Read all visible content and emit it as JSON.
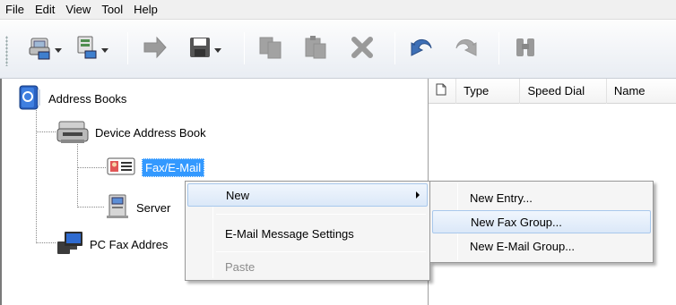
{
  "menubar": {
    "items": [
      {
        "label": "File"
      },
      {
        "label": "Edit"
      },
      {
        "label": "View"
      },
      {
        "label": "Tool"
      },
      {
        "label": "Help"
      }
    ]
  },
  "toolbar": {
    "buttons": [
      {
        "icon": "address-book-dropdown-icon",
        "has_dropdown": true
      },
      {
        "icon": "network-dropdown-icon",
        "has_dropdown": true
      },
      {
        "icon": "import-arrow-icon",
        "has_dropdown": false
      },
      {
        "icon": "save-disk-icon",
        "has_dropdown": true
      },
      {
        "icon": "copy-icon",
        "has_dropdown": false
      },
      {
        "icon": "paste-icon",
        "has_dropdown": false
      },
      {
        "icon": "delete-x-icon",
        "has_dropdown": false
      },
      {
        "icon": "undo-icon",
        "has_dropdown": false
      },
      {
        "icon": "redo-icon",
        "has_dropdown": false
      },
      {
        "icon": "find-binoculars-icon",
        "has_dropdown": false
      }
    ]
  },
  "tree": {
    "root": {
      "label": "Address Books",
      "icon": "address-books-icon"
    },
    "device_book": {
      "label": "Device Address Book",
      "icon": "printer-device-icon"
    },
    "fax_email": {
      "label": "Fax/E-Mail",
      "icon": "fax-email-card-icon",
      "selected": true
    },
    "server": {
      "label": "Server",
      "icon": "server-icon"
    },
    "pc_fax": {
      "label": "PC Fax Addres",
      "icon": "pc-fax-icon"
    }
  },
  "list": {
    "columns": [
      {
        "label": "",
        "icon": "document-icon"
      },
      {
        "label": "Type"
      },
      {
        "label": "Speed Dial"
      },
      {
        "label": "Name"
      }
    ]
  },
  "context_menu": {
    "items": [
      {
        "label": "New",
        "has_submenu": true,
        "highlighted": true
      },
      {
        "label": "E-Mail Message Settings",
        "disabled": false
      },
      {
        "label": "Paste",
        "disabled": true
      }
    ]
  },
  "submenu": {
    "items": [
      {
        "label": "New Entry...",
        "highlighted": false
      },
      {
        "label": "New Fax Group...",
        "highlighted": true
      },
      {
        "label": "New E-Mail Group...",
        "highlighted": false
      }
    ]
  },
  "colors": {
    "selection": "#3399ff",
    "menu_highlight_border": "#a8c8ec",
    "disabled_text": "#8c8c8c"
  }
}
